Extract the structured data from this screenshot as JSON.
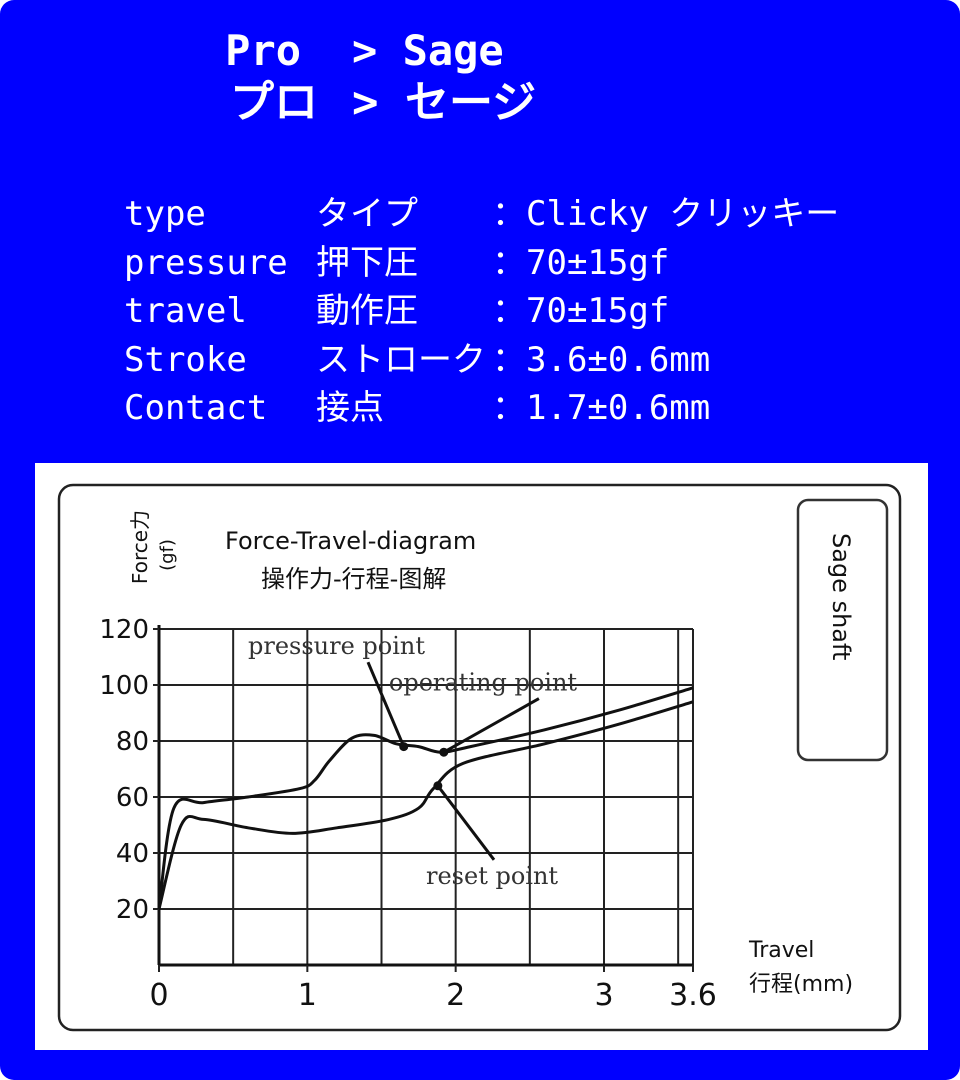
{
  "breadcrumb": {
    "en_from": "Pro",
    "en_to": "> Sage",
    "jp_from": "プロ",
    "jp_to": "> セージ"
  },
  "specs": [
    {
      "label": "type",
      "jp": "タイプ",
      "colon": "：",
      "value": "Clicky クリッキー"
    },
    {
      "label": "pressure",
      "jp": "押下圧",
      "colon": "：",
      "value": "70±15gf"
    },
    {
      "label": "travel",
      "jp": "動作圧",
      "colon": "：",
      "value": "70±15gf"
    },
    {
      "label": "Stroke",
      "jp": "ストローク",
      "colon": "：",
      "value": "3.6±0.6mm"
    },
    {
      "label": "Contact",
      "jp": "接点",
      "colon": "：",
      "value": "1.7±0.6mm"
    }
  ],
  "colors": {
    "background": "#0000ff",
    "text": "#ffffff",
    "chart_ink": "#111111"
  },
  "chart_data": {
    "type": "line",
    "title": "Force-Travel-diagram",
    "subtitle": "操作力-行程-图解",
    "ylabel": "Force力",
    "yunit": "(gf)",
    "xlabel": "Travel",
    "xlabel_jp": "行程(mm)",
    "xlim": [
      0,
      3.6
    ],
    "ylim": [
      0,
      120
    ],
    "x_ticks": [
      "0",
      "1",
      "2",
      "3",
      "3.6"
    ],
    "y_ticks": [
      "20",
      "40",
      "60",
      "80",
      "100",
      "120"
    ],
    "grid": true,
    "side_label": "Sage shaft",
    "series": [
      {
        "values": [
          [
            0,
            20
          ],
          [
            0.1,
            56
          ],
          [
            0.3,
            58
          ],
          [
            0.6,
            60
          ],
          [
            0.95,
            63
          ],
          [
            1.05,
            66
          ],
          [
            1.15,
            73
          ],
          [
            1.3,
            81
          ],
          [
            1.45,
            82
          ],
          [
            1.6,
            79
          ],
          [
            1.75,
            78
          ],
          [
            1.9,
            76
          ],
          [
            2.1,
            78
          ],
          [
            2.6,
            84
          ],
          [
            3.1,
            91
          ],
          [
            3.6,
            99
          ]
        ]
      },
      {
        "values": [
          [
            0,
            20
          ],
          [
            0.15,
            50
          ],
          [
            0.3,
            52
          ],
          [
            0.6,
            49
          ],
          [
            0.9,
            47
          ],
          [
            1.2,
            49
          ],
          [
            1.55,
            52
          ],
          [
            1.75,
            56
          ],
          [
            1.85,
            63
          ],
          [
            2.05,
            72
          ],
          [
            2.6,
            79
          ],
          [
            3.1,
            86
          ],
          [
            3.6,
            94
          ]
        ]
      }
    ],
    "annotations": [
      {
        "text": "pressure point",
        "text_pos": [
          0.6,
          111
        ],
        "point": [
          1.65,
          78
        ]
      },
      {
        "text": "operating point",
        "text_pos": [
          1.55,
          98
        ],
        "point": [
          1.92,
          76
        ]
      },
      {
        "text": "reset point",
        "text_pos": [
          1.8,
          29
        ],
        "point": [
          1.88,
          64
        ]
      }
    ]
  }
}
